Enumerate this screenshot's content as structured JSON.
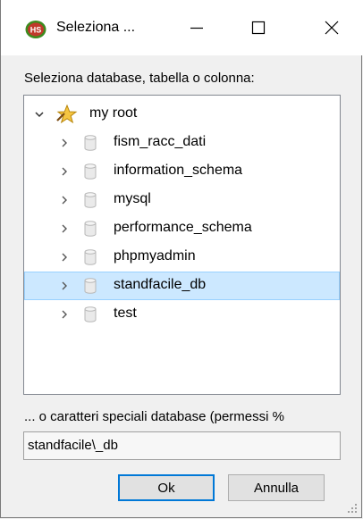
{
  "window": {
    "title": "Seleziona ...",
    "app_icon": "hs-logo-icon",
    "icon_label": "HS"
  },
  "prompt": "Seleziona database, tabella o colonna:",
  "tree": {
    "root": {
      "label": "my root",
      "icon": "star-icon",
      "expanded": true
    },
    "items": [
      {
        "label": "fism_racc_dati",
        "icon": "database-icon"
      },
      {
        "label": "information_schema",
        "icon": "database-icon"
      },
      {
        "label": "mysql",
        "icon": "database-icon"
      },
      {
        "label": "performance_schema",
        "icon": "database-icon"
      },
      {
        "label": "phpmyadmin",
        "icon": "database-icon"
      },
      {
        "label": "standfacile_db",
        "icon": "database-icon",
        "selected": true
      },
      {
        "label": "test",
        "icon": "database-icon"
      }
    ]
  },
  "special_chars_caption": "... o caratteri speciali database (permessi %",
  "pattern_field": {
    "value": "standfacile\\_db"
  },
  "buttons": {
    "ok": "Ok",
    "cancel": "Annulla"
  },
  "colors": {
    "selection_bg": "#cce8ff",
    "selection_border": "#99d1ff",
    "default_button_border": "#0078d7"
  }
}
